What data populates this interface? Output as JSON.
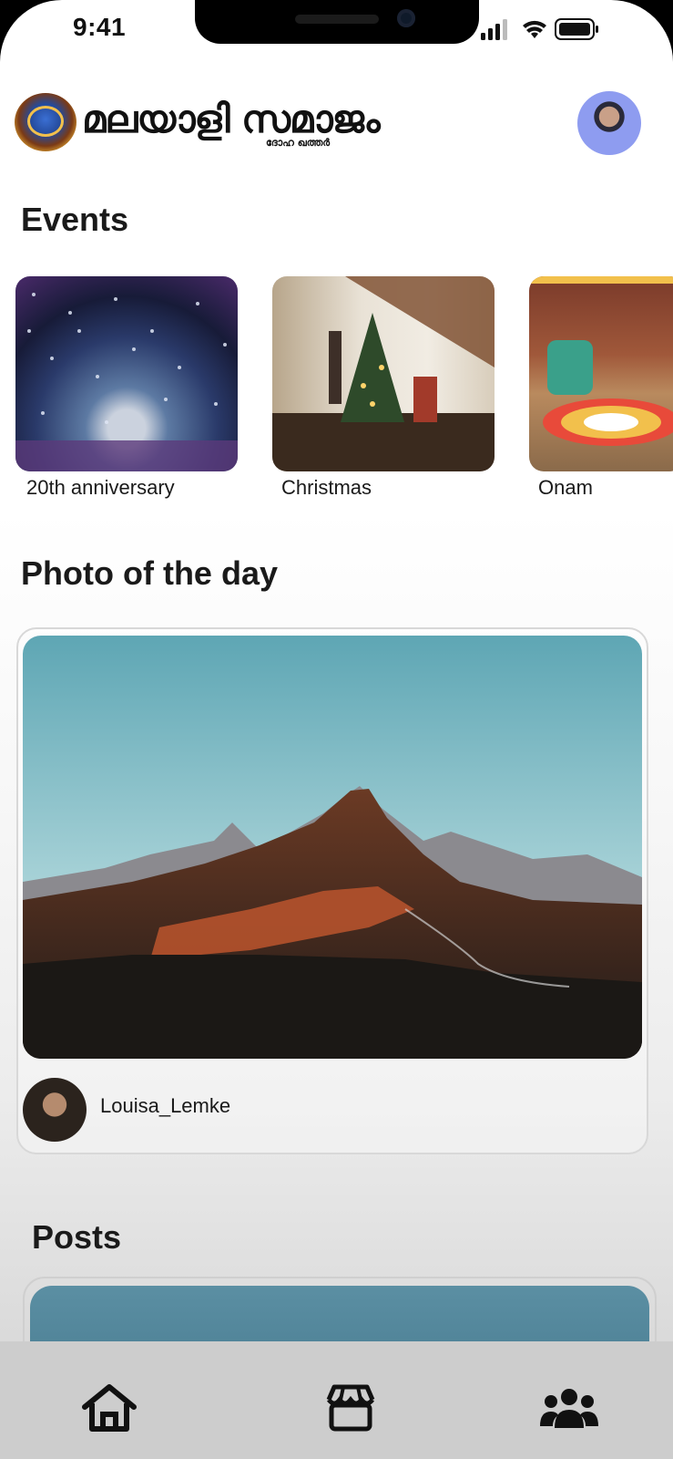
{
  "status_bar": {
    "time": "9:41"
  },
  "header": {
    "logo_text": "മലയാളി സമാജം",
    "logo_subtext": "ദോഹ ഖത്തർ"
  },
  "events": {
    "title": "Events",
    "items": [
      {
        "label": "20th anniversary"
      },
      {
        "label": "Christmas"
      },
      {
        "label": "Onam"
      }
    ]
  },
  "photo_of_day": {
    "title": "Photo of the day",
    "author": "Louisa_Lemke"
  },
  "posts": {
    "title": "Posts"
  },
  "tabbar": {
    "items": [
      {
        "icon": "home-icon"
      },
      {
        "icon": "store-icon"
      },
      {
        "icon": "community-icon"
      }
    ]
  },
  "colors": {
    "tabbar_bg": "#cdcdcd",
    "text": "#1a1a1a"
  }
}
